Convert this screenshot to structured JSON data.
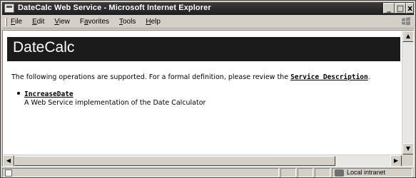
{
  "window": {
    "title": "DateCalc Web Service - Microsoft Internet Explorer",
    "controls": {
      "minimize": "_",
      "maximize": "□",
      "close": "x"
    }
  },
  "menu": {
    "items": [
      {
        "u": "F",
        "rest": "ile"
      },
      {
        "u": "E",
        "rest": "dit"
      },
      {
        "u": "V",
        "rest": "iew"
      },
      {
        "pre": "F",
        "u": "a",
        "rest": "vorites"
      },
      {
        "u": "T",
        "rest": "ools"
      },
      {
        "u": "H",
        "rest": "elp"
      }
    ]
  },
  "page": {
    "service_title": "DateCalc",
    "intro_text": "The following operations are supported. For a formal definition, please review the ",
    "service_description_link": "Service Description",
    "intro_end": ".",
    "operations": [
      {
        "name": "IncreaseDate",
        "description": "A Web Service implementation of the Date Calculator"
      }
    ]
  },
  "status": {
    "zone": "Local intranet"
  },
  "icons": {
    "app": "ie-page-icon",
    "throbber": "windows-logo-icon",
    "status_page": "page-icon",
    "zone": "intranet-zone-icon"
  }
}
